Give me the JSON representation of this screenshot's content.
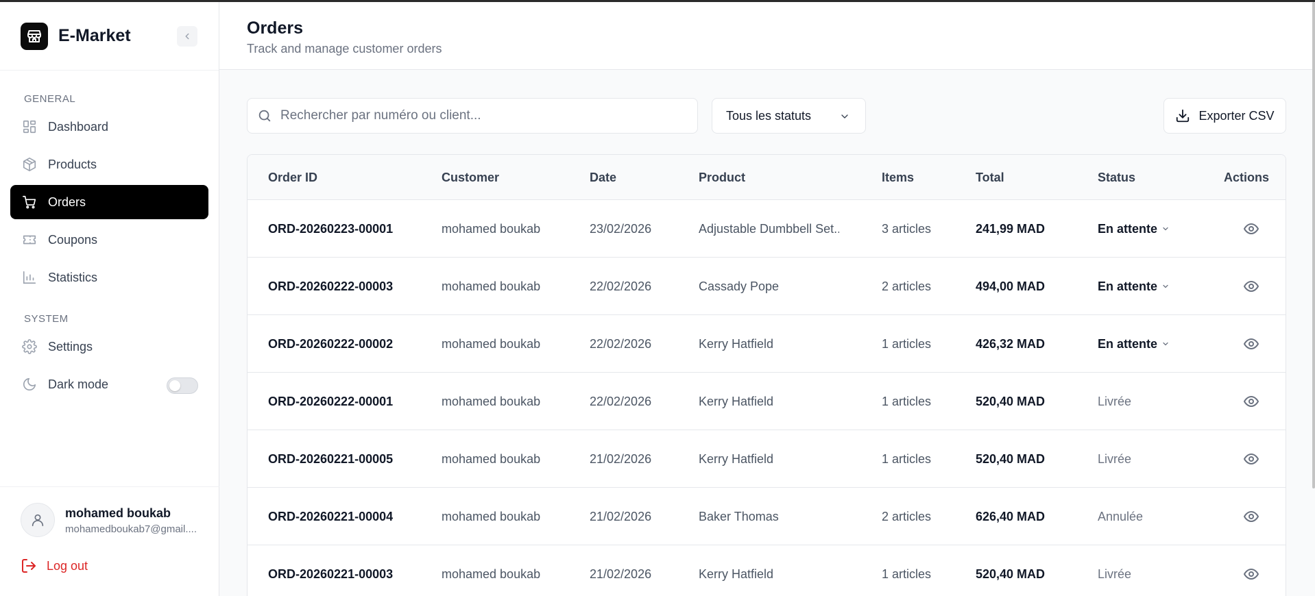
{
  "app": {
    "name": "E-Market",
    "logo_icon": "store-icon",
    "collapse_icon": "chevron-left-icon"
  },
  "sidebar": {
    "general_label": "GENERAL",
    "system_label": "SYSTEM",
    "general_items": [
      {
        "label": "Dashboard",
        "icon": "layout-grid-icon",
        "active": false
      },
      {
        "label": "Products",
        "icon": "package-icon",
        "active": false
      },
      {
        "label": "Orders",
        "icon": "shopping-cart-icon",
        "active": true
      },
      {
        "label": "Coupons",
        "icon": "ticket-icon",
        "active": false
      },
      {
        "label": "Statistics",
        "icon": "bar-chart-icon",
        "active": false
      }
    ],
    "system_items": [
      {
        "label": "Settings",
        "icon": "gear-icon"
      },
      {
        "label": "Dark mode",
        "icon": "moon-icon",
        "toggle_on": false
      }
    ]
  },
  "user": {
    "name": "mohamed boukab",
    "email": "mohamedboukab7@gmail....",
    "logout_label": "Log out"
  },
  "header": {
    "title": "Orders",
    "subtitle": "Track and manage customer orders"
  },
  "filters": {
    "search_placeholder": "Rechercher par numéro ou client...",
    "search_value": "",
    "status_selected": "Tous les statuts",
    "export_label": "Exporter CSV"
  },
  "table": {
    "columns": [
      "Order ID",
      "Customer",
      "Date",
      "Product",
      "Items",
      "Total",
      "Status",
      "Actions"
    ],
    "rows": [
      {
        "id": "ORD-20260223-00001",
        "customer": "mohamed boukab",
        "date": "23/02/2026",
        "product": "Adjustable Dumbbell Set...",
        "items": "3 articles",
        "total": "241,99 MAD",
        "status": "En attente",
        "editable": true
      },
      {
        "id": "ORD-20260222-00003",
        "customer": "mohamed boukab",
        "date": "22/02/2026",
        "product": "Cassady Pope",
        "items": "2 articles",
        "total": "494,00 MAD",
        "status": "En attente",
        "editable": true
      },
      {
        "id": "ORD-20260222-00002",
        "customer": "mohamed boukab",
        "date": "22/02/2026",
        "product": "Kerry Hatfield",
        "items": "1 articles",
        "total": "426,32 MAD",
        "status": "En attente",
        "editable": true
      },
      {
        "id": "ORD-20260222-00001",
        "customer": "mohamed boukab",
        "date": "22/02/2026",
        "product": "Kerry Hatfield",
        "items": "1 articles",
        "total": "520,40 MAD",
        "status": "Livrée",
        "editable": false
      },
      {
        "id": "ORD-20260221-00005",
        "customer": "mohamed boukab",
        "date": "21/02/2026",
        "product": "Kerry Hatfield",
        "items": "1 articles",
        "total": "520,40 MAD",
        "status": "Livrée",
        "editable": false
      },
      {
        "id": "ORD-20260221-00004",
        "customer": "mohamed boukab",
        "date": "21/02/2026",
        "product": "Baker Thomas",
        "items": "2 articles",
        "total": "626,40 MAD",
        "status": "Annulée",
        "editable": false
      },
      {
        "id": "ORD-20260221-00003",
        "customer": "mohamed boukab",
        "date": "21/02/2026",
        "product": "Kerry Hatfield",
        "items": "1 articles",
        "total": "520,40 MAD",
        "status": "Livrée",
        "editable": false
      }
    ]
  },
  "colors": {
    "accent": "#000000",
    "danger": "#dc2626",
    "muted": "#6b7280",
    "border": "#e5e7eb"
  }
}
